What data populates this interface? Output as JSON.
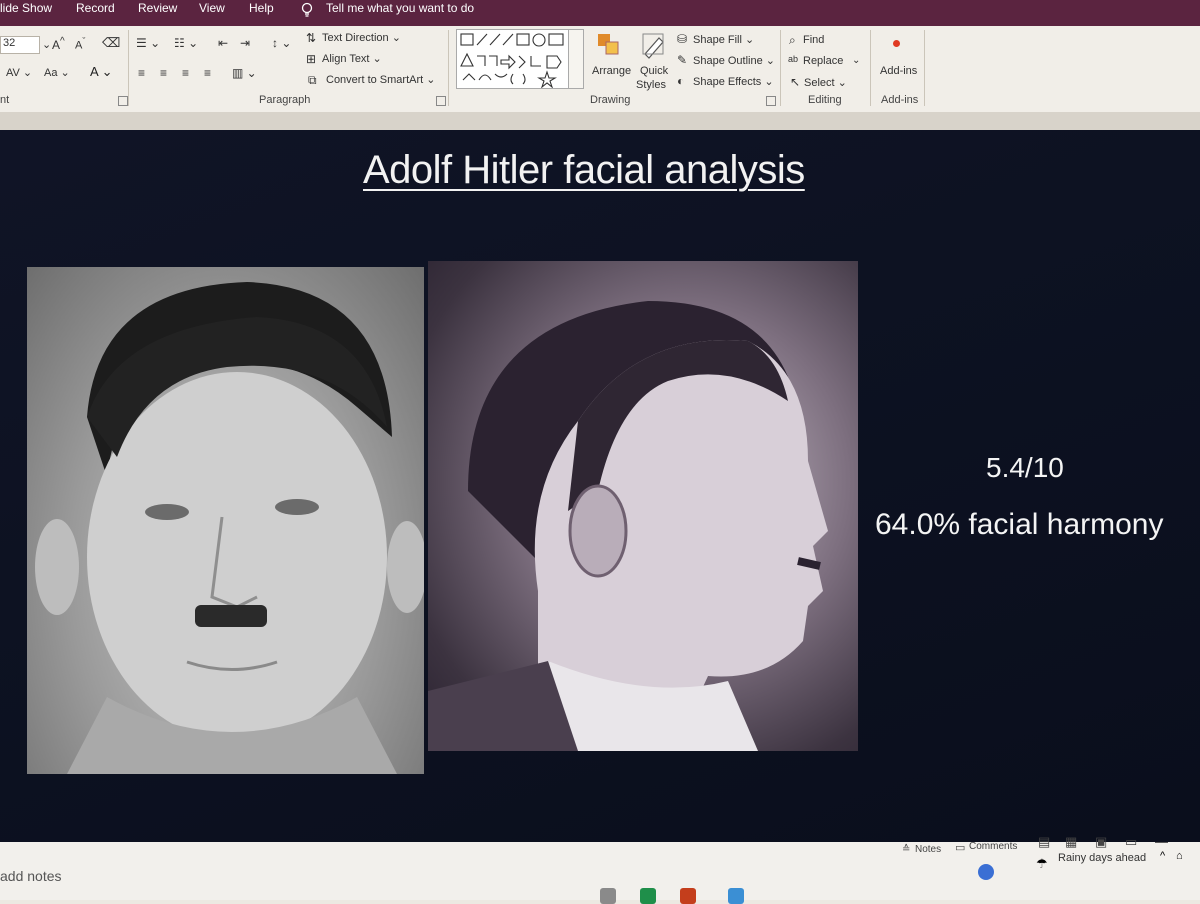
{
  "tabs": [
    "lide Show",
    "Record",
    "Review",
    "View",
    "Help"
  ],
  "tell_me": "Tell me what you want to do",
  "ribbon": {
    "font_size": "32",
    "font_group_label": "nt",
    "paragraph": {
      "label": "Paragraph",
      "text_direction": "Text Direction",
      "align_text": "Align Text",
      "convert_smartart": "Convert to SmartArt"
    },
    "drawing": {
      "label": "Drawing",
      "arrange": "Arrange",
      "quick_styles_1": "Quick",
      "quick_styles_2": "Styles",
      "shape_fill": "Shape Fill",
      "shape_outline": "Shape Outline",
      "shape_effects": "Shape Effects"
    },
    "editing": {
      "label": "Editing",
      "find": "Find",
      "replace": "Replace",
      "select": "Select"
    },
    "addins": {
      "button": "Add-ins",
      "label": "Add-ins"
    }
  },
  "slide": {
    "title": "Adolf Hitler facial analysis",
    "score": "5.4/10",
    "harmony": "64.0% facial harmony"
  },
  "notes_placeholder": "add notes",
  "status": {
    "notes": "Notes",
    "comments": "Comments",
    "weather": "Rainy days ahead"
  },
  "colors": {
    "tab_bar": "#5b2440",
    "slide_bg": "#0d1222",
    "accent": "#e03a22"
  }
}
